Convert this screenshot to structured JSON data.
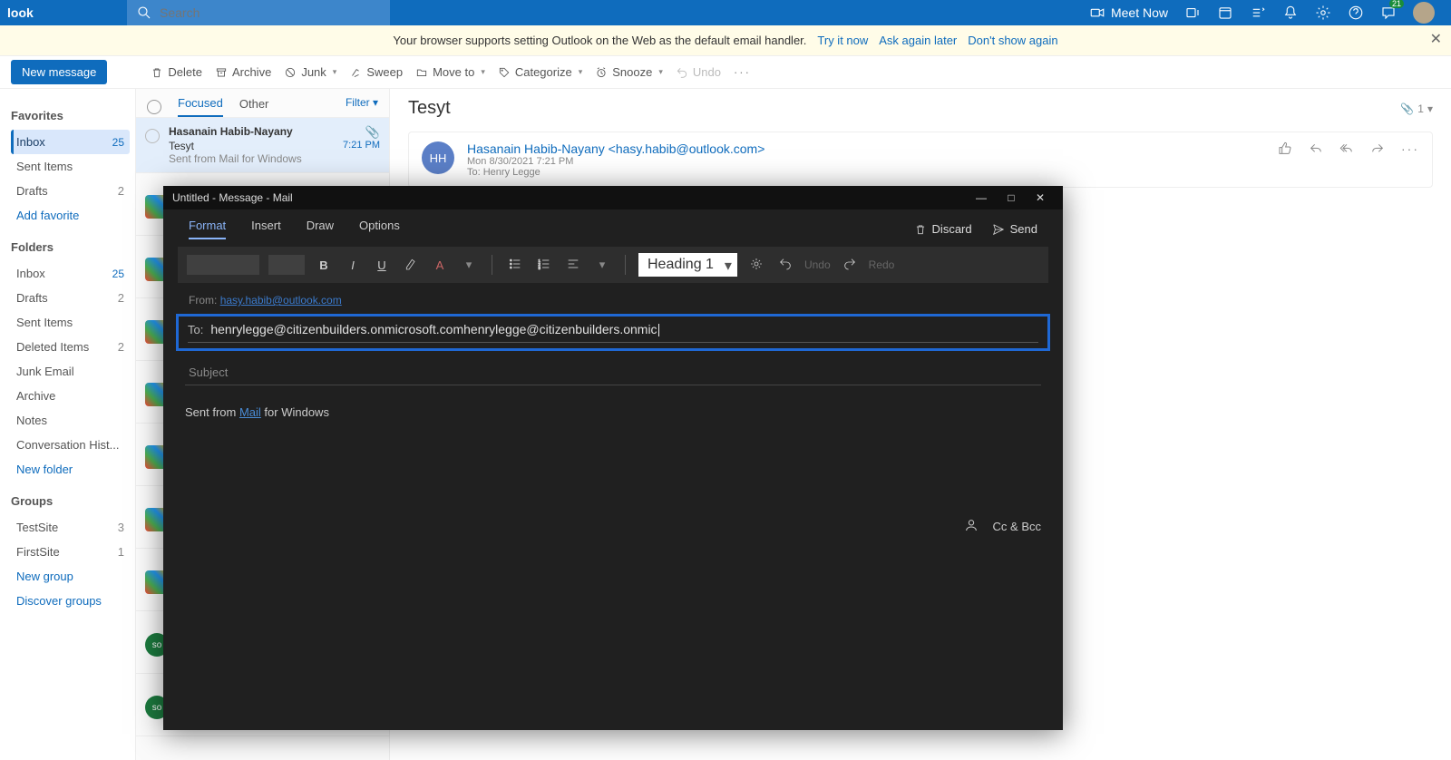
{
  "header": {
    "brand": "look",
    "search_placeholder": "Search",
    "meet_now": "Meet Now",
    "notif_count": "21"
  },
  "info_bar": {
    "text": "Your browser supports setting Outlook on the Web as the default email handler.",
    "try": "Try it now",
    "later": "Ask again later",
    "dont": "Don't show again"
  },
  "toolbar": {
    "new_message": "New message",
    "delete": "Delete",
    "archive": "Archive",
    "junk": "Junk",
    "sweep": "Sweep",
    "move_to": "Move to",
    "categorize": "Categorize",
    "snooze": "Snooze",
    "undo": "Undo"
  },
  "sidebar": {
    "favorites": "Favorites",
    "inbox": "Inbox",
    "inbox_count": "25",
    "sent": "Sent Items",
    "drafts": "Drafts",
    "drafts_count": "2",
    "add_fav": "Add favorite",
    "folders": "Folders",
    "deleted": "Deleted Items",
    "deleted_count": "2",
    "junk": "Junk Email",
    "archive": "Archive",
    "notes": "Notes",
    "conv": "Conversation Hist...",
    "new_folder": "New folder",
    "groups": "Groups",
    "g1": "TestSite",
    "g1c": "3",
    "g2": "FirstSite",
    "g2c": "1",
    "new_group": "New group",
    "discover": "Discover groups"
  },
  "msg_list": {
    "focused": "Focused",
    "other": "Other",
    "filter": "Filter",
    "m1_sender": "Hasanain Habib-Nayany",
    "m1_subj": "Tesyt",
    "m1_prev": "Sent from Mail for Windows",
    "m1_time": "7:21 PM"
  },
  "reading": {
    "subject": "Tesyt",
    "count": "1",
    "from": "Hasanain Habib-Nayany <hasy.habib@outlook.com>",
    "initials": "HH",
    "date": "Mon 8/30/2021 7:21 PM",
    "to_line": "To:  Henry Legge"
  },
  "compose": {
    "title": "Untitled - Message - Mail",
    "tabs": {
      "format": "Format",
      "insert": "Insert",
      "draw": "Draw",
      "options": "Options"
    },
    "discard": "Discard",
    "send": "Send",
    "heading": "Heading 1",
    "undo_txt": "Undo",
    "redo_txt": "Redo",
    "from_lbl": "From:",
    "from_addr": "hasy.habib@outlook.com",
    "to_lbl": "To:",
    "to_value": "henrylegge@citizenbuilders.onmicrosoft.comhenrylegge@citizenbuilders.onmic",
    "ccbcc": "Cc & Bcc",
    "subject_ph": "Subject",
    "body_prefix": "Sent from ",
    "body_link": "Mail",
    "body_suffix": " for Windows"
  }
}
